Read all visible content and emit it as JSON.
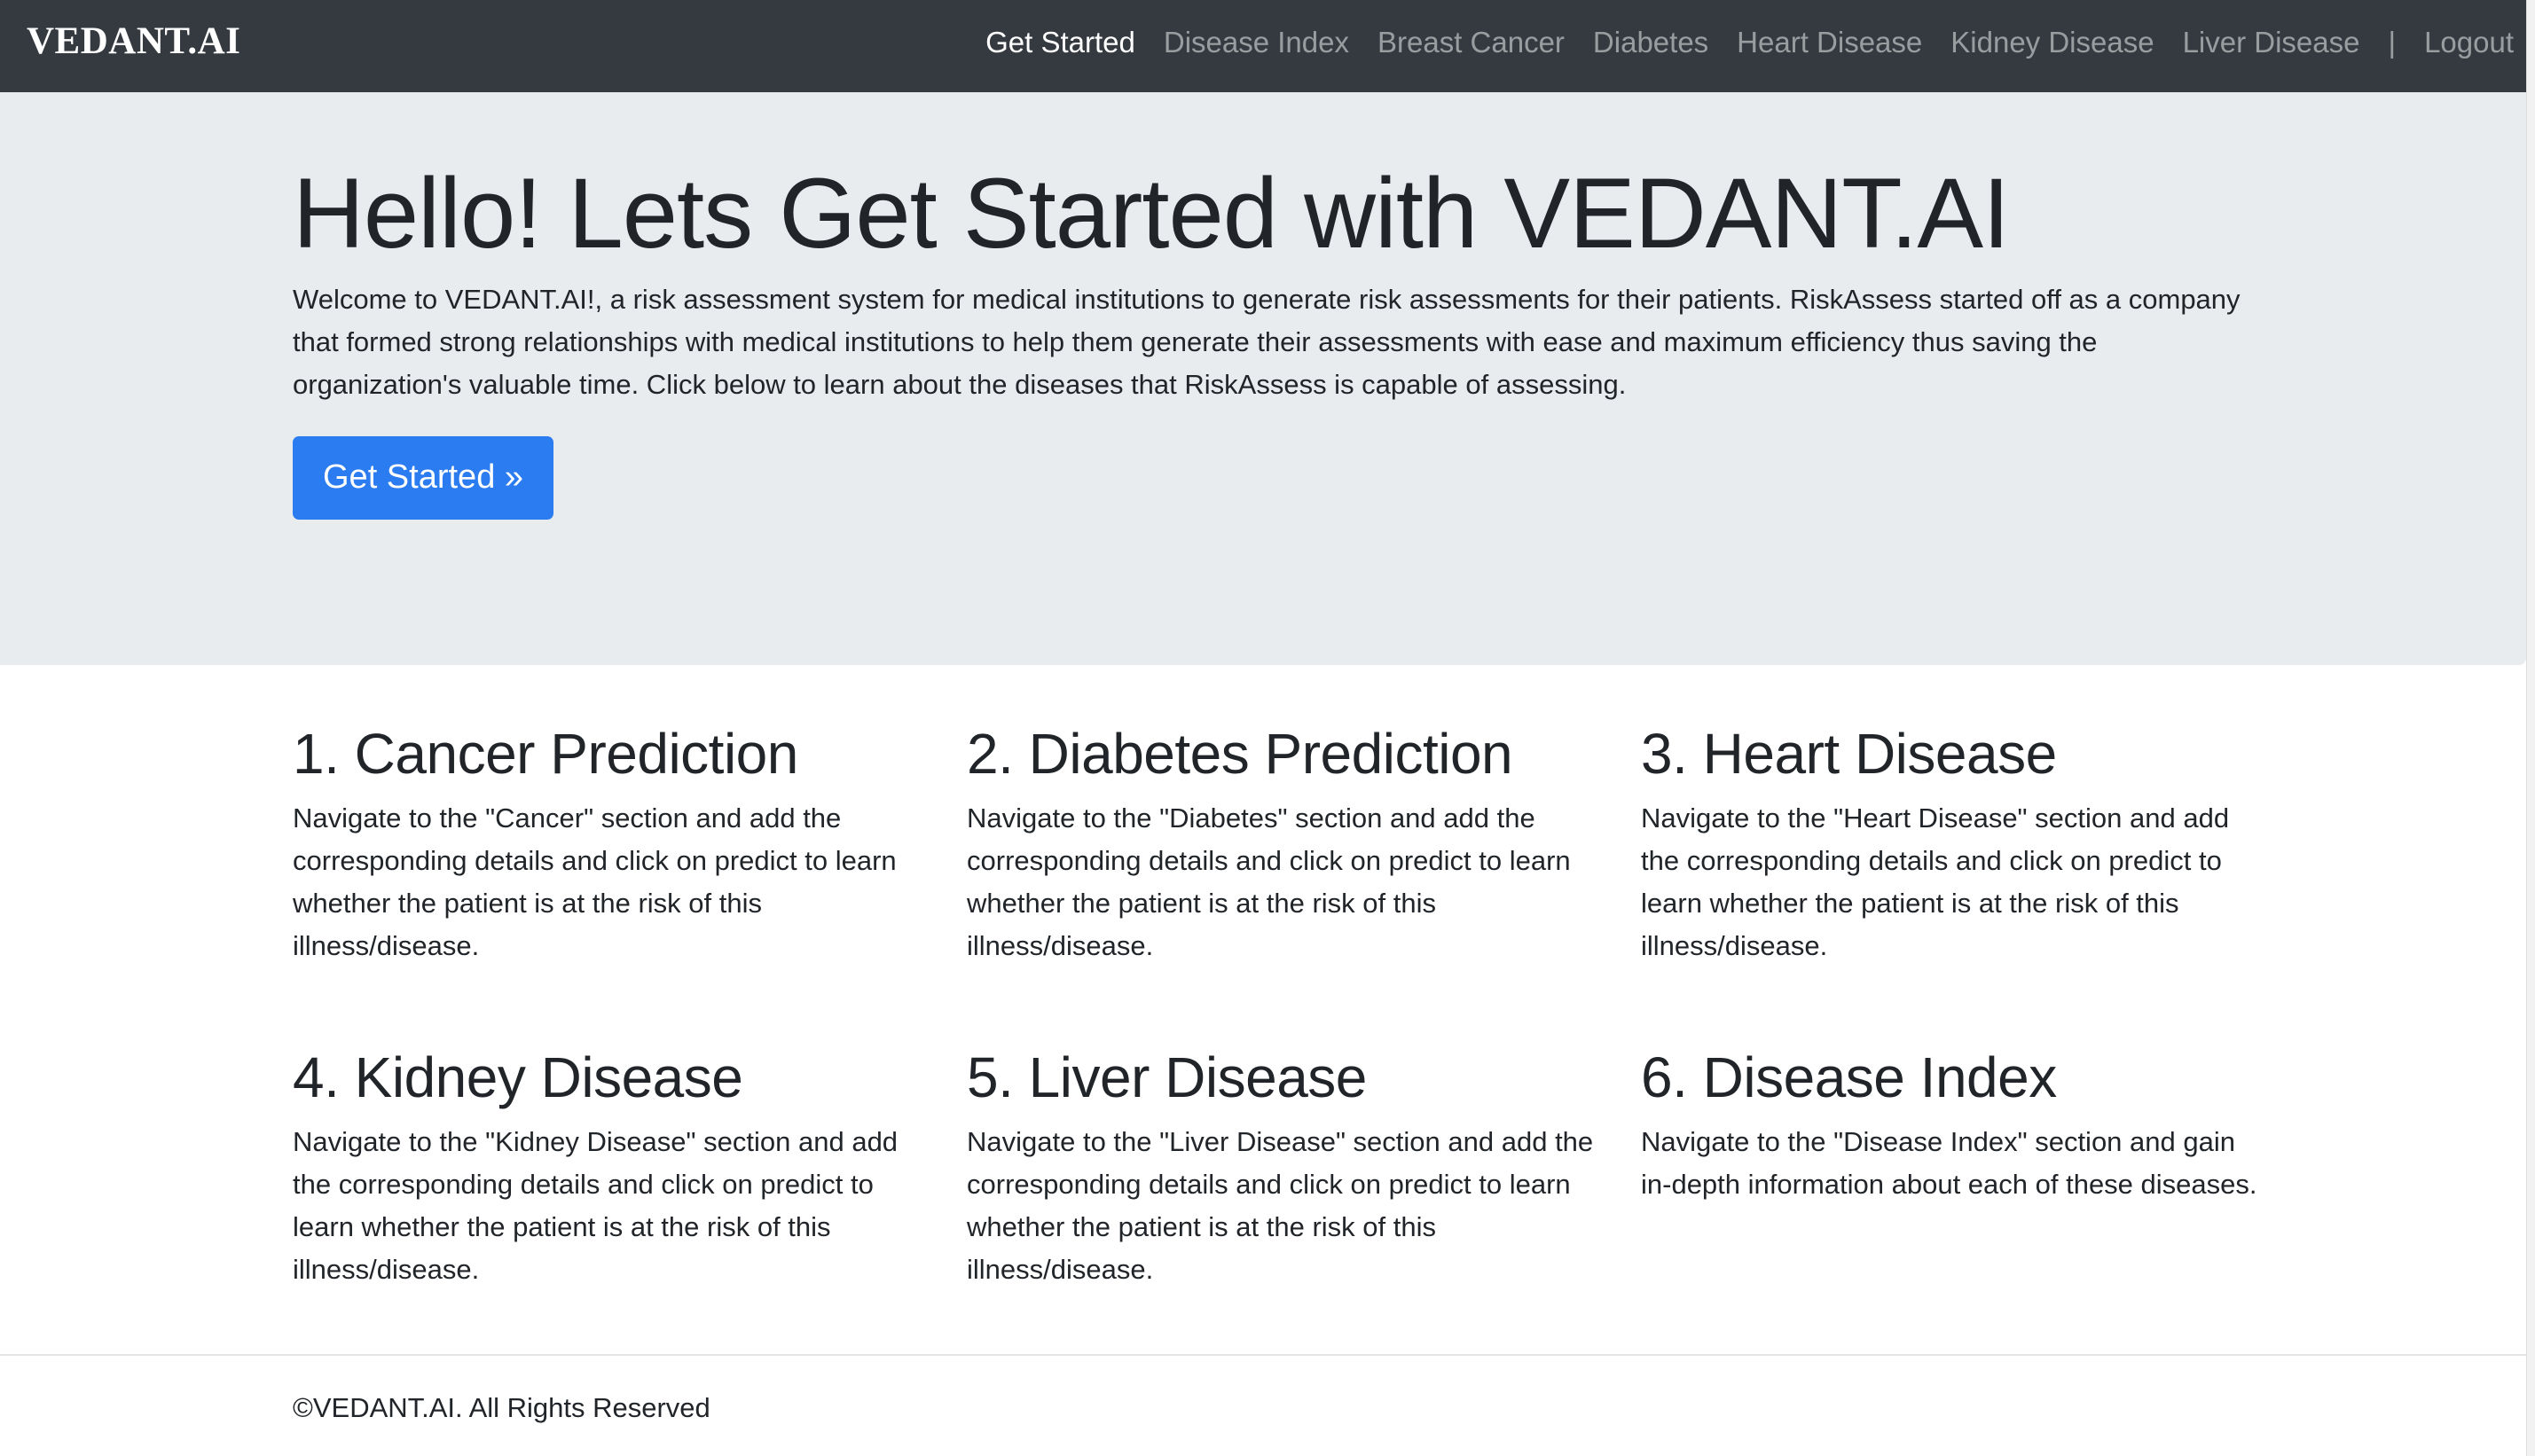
{
  "navbar": {
    "brand": "VEDANT.AI",
    "items": [
      {
        "label": "Get Started",
        "active": true
      },
      {
        "label": "Disease Index",
        "active": false
      },
      {
        "label": "Breast Cancer",
        "active": false
      },
      {
        "label": "Diabetes",
        "active": false
      },
      {
        "label": "Heart Disease",
        "active": false
      },
      {
        "label": "Kidney Disease",
        "active": false
      },
      {
        "label": "Liver Disease",
        "active": false
      }
    ],
    "separator": "|",
    "logout": "Logout"
  },
  "hero": {
    "title": "Hello! Lets Get Started with VEDANT.AI",
    "lead": "Welcome to VEDANT.AI!, a risk assessment system for medical institutions to generate risk assessments for their patients. RiskAssess started off as a company that formed strong relationships with medical institutions to help them generate their assessments with ease and maximum efficiency thus saving the organization's valuable time. Click below to learn about the diseases that RiskAssess is capable of assessing.",
    "button": "Get Started »"
  },
  "features": [
    {
      "title": "1. Cancer Prediction",
      "text": "Navigate to the \"Cancer\" section and add the corresponding details and click on predict to learn whether the patient is at the risk of this illness/disease."
    },
    {
      "title": "2. Diabetes Prediction",
      "text": "Navigate to the \"Diabetes\" section and add the corresponding details and click on predict to learn whether the patient is at the risk of this illness/disease."
    },
    {
      "title": "3. Heart Disease",
      "text": "Navigate to the \"Heart Disease\" section and add the corresponding details and click on predict to learn whether the patient is at the risk of this illness/disease."
    },
    {
      "title": "4. Kidney Disease",
      "text": "Navigate to the \"Kidney Disease\" section and add the corresponding details and click on predict to learn whether the patient is at the risk of this illness/disease."
    },
    {
      "title": "5. Liver Disease",
      "text": "Navigate to the \"Liver Disease\" section and add the corresponding details and click on predict to learn whether the patient is at the risk of this illness/disease."
    },
    {
      "title": "6. Disease Index",
      "text": "Navigate to the \"Disease Index\" section and gain in-depth information about each of these diseases."
    }
  ],
  "footer": {
    "text": "©VEDANT.AI. All Rights Reserved"
  },
  "colors": {
    "navbar_bg": "#343a40",
    "jumbotron_bg": "#e9ecef",
    "primary": "#2b7cf0",
    "text": "#212529"
  }
}
